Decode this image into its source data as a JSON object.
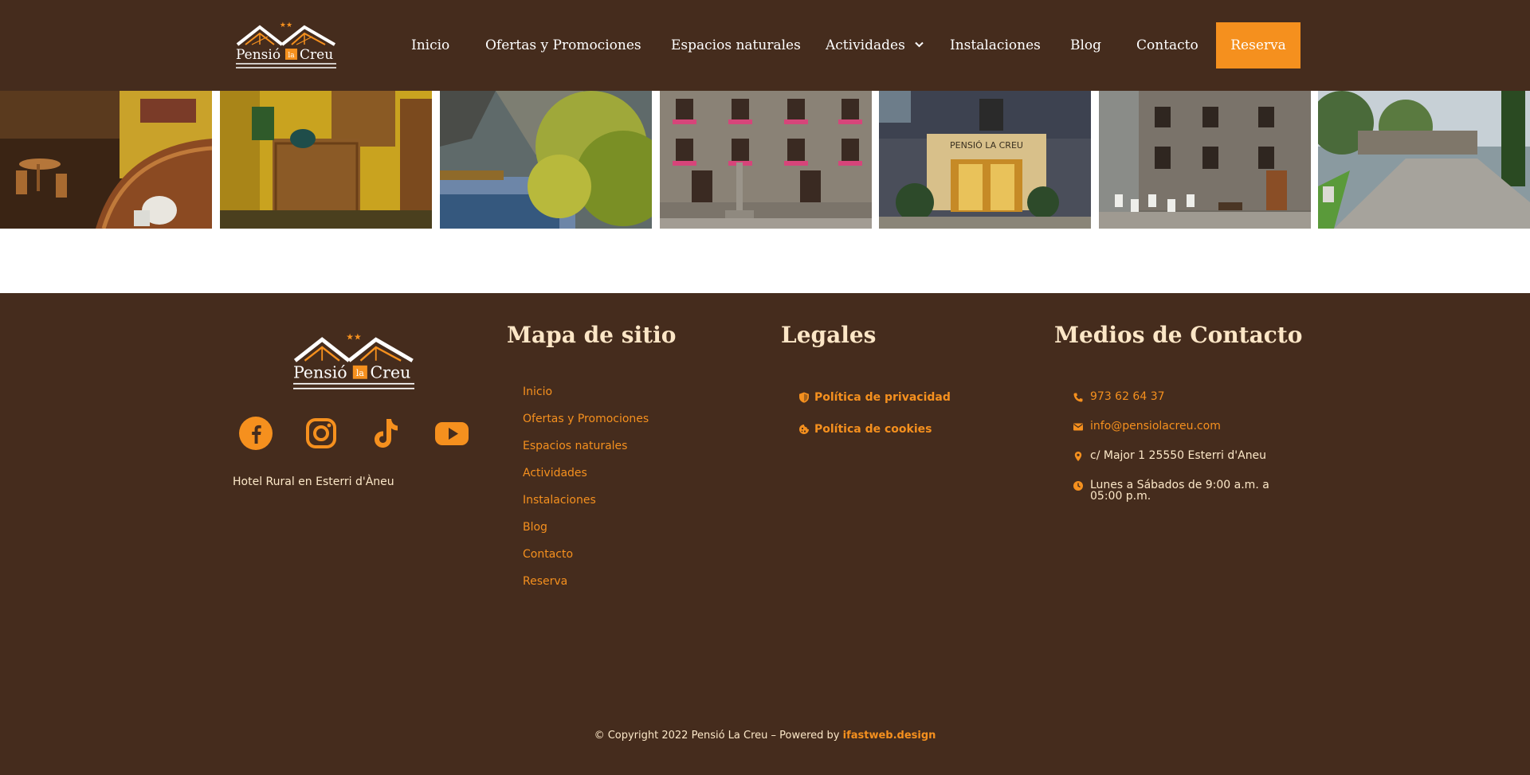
{
  "brand": {
    "name_left": "Pensió",
    "name_mid": "la",
    "name_right": "Creu",
    "stars": "★★"
  },
  "nav": {
    "items": [
      {
        "label": "Inicio"
      },
      {
        "label": "Ofertas y Promociones"
      },
      {
        "label": "Espacios naturales"
      },
      {
        "label": "Actividades"
      },
      {
        "label": "Instalaciones"
      },
      {
        "label": "Blog"
      },
      {
        "label": "Contacto"
      }
    ],
    "dropdown_icon": "chevron-down-icon",
    "reserva": "Reserva"
  },
  "gallery": {
    "photos": [
      {
        "subject": "bar-interior"
      },
      {
        "subject": "reception-desk"
      },
      {
        "subject": "lake-autumn"
      },
      {
        "subject": "stone-facade-flowers"
      },
      {
        "subject": "entrance-night"
      },
      {
        "subject": "terrace-facade"
      },
      {
        "subject": "village-road"
      }
    ]
  },
  "footer": {
    "tagline": "Hotel Rural en Esterri d'Àneu",
    "social": [
      {
        "icon": "facebook-icon"
      },
      {
        "icon": "instagram-icon"
      },
      {
        "icon": "tiktok-icon"
      },
      {
        "icon": "youtube-icon"
      }
    ],
    "sitemap": {
      "heading": "Mapa de sitio",
      "links": [
        "Inicio",
        "Ofertas y Promociones",
        "Espacios naturales",
        "Actividades",
        "Instalaciones",
        "Blog",
        "Contacto",
        "Reserva"
      ]
    },
    "legal": {
      "heading": "Legales",
      "links": [
        {
          "label": "Política de privacidad",
          "icon": "shield-icon"
        },
        {
          "label": "Política de cookies",
          "icon": "cookie-icon"
        }
      ]
    },
    "contact": {
      "heading": "Medios de Contacto",
      "phone": "973 62 64 37",
      "email": "info@pensiolacreu.com",
      "address": "c/ Major 1 25550 Esterri d'Aneu",
      "hours_line1": "Lunes a Sábados de 9:00 a.m. a",
      "hours_line2": "05:00 p.m."
    },
    "copyright_text": "© Copyright 2022 Pensió La Creu – Powered by ",
    "powered_link": "ifastweb.design"
  },
  "colors": {
    "background": "#452c1d",
    "accent": "#f5901e",
    "cream": "#fce8c8"
  }
}
